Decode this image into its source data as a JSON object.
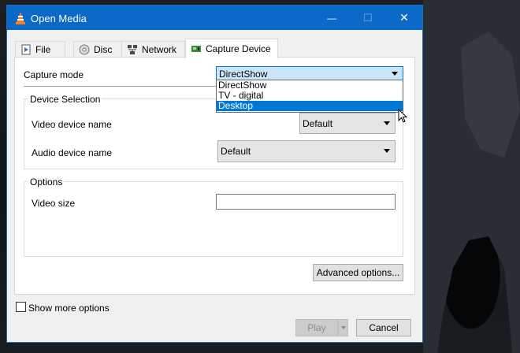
{
  "window": {
    "title": "Open Media"
  },
  "titlebar": {
    "minimize": "—",
    "maximize": "☐",
    "close": "✕"
  },
  "tabs": [
    {
      "label": "File",
      "icon": "file-icon"
    },
    {
      "label": "Disc",
      "icon": "disc-icon"
    },
    {
      "label": "Network",
      "icon": "network-icon"
    },
    {
      "label": "Capture Device",
      "icon": "capture-card-icon",
      "active": true
    }
  ],
  "capture": {
    "label": "Capture mode",
    "selected": "DirectShow",
    "options": [
      "DirectShow",
      "TV - digital",
      "Desktop"
    ],
    "highlighted": "Desktop"
  },
  "device_selection": {
    "title": "Device Selection",
    "video_label": "Video device name",
    "video_value": "Default",
    "audio_label": "Audio device name",
    "audio_value": "Default"
  },
  "options": {
    "title": "Options",
    "video_size_label": "Video size",
    "video_size_value": ""
  },
  "buttons": {
    "advanced": "Advanced options...",
    "play": "Play",
    "cancel": "Cancel"
  },
  "show_more": {
    "label": "Show more options",
    "checked": false
  },
  "colors": {
    "titlebar": "#0b69c7",
    "highlight": "#0078d7"
  }
}
